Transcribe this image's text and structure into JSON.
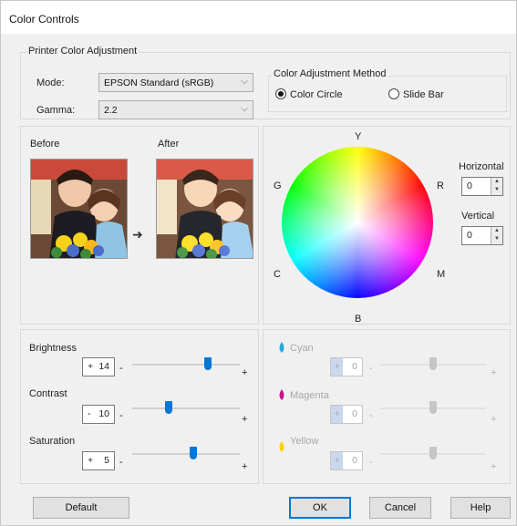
{
  "window": {
    "title": "Color Controls"
  },
  "printer_adjustment": {
    "group_label": "Printer Color Adjustment",
    "mode_label": "Mode:",
    "mode_value": "EPSON Standard (sRGB)",
    "gamma_label": "Gamma:",
    "gamma_value": "2.2"
  },
  "method": {
    "group_label": "Color Adjustment Method",
    "options": [
      {
        "label": "Color Circle",
        "selected": true
      },
      {
        "label": "Slide Bar",
        "selected": false
      }
    ]
  },
  "preview": {
    "before_label": "Before",
    "after_label": "After"
  },
  "color_circle": {
    "labels": {
      "top": "Y",
      "upper_left": "G",
      "upper_right": "R",
      "lower_left": "C",
      "lower_right": "M",
      "bottom": "B"
    },
    "horizontal_label": "Horizontal",
    "horizontal_value": "0",
    "vertical_label": "Vertical",
    "vertical_value": "0"
  },
  "adjustments": [
    {
      "label": "Brightness",
      "sign": "+",
      "value": "14",
      "level": 0.72,
      "color": "#0078d7"
    },
    {
      "label": "Contrast",
      "sign": "-",
      "value": "10",
      "level": 0.33,
      "color": "#0078d7"
    },
    {
      "label": "Saturation",
      "sign": "+",
      "value": "5",
      "level": 0.57,
      "color": "#0078d7"
    }
  ],
  "ink": [
    {
      "label": "Cyan",
      "icon": "cyan-drop-icon",
      "icon_color": "#29a7e0",
      "sign": "+",
      "value": "0",
      "level": 0.5
    },
    {
      "label": "Magenta",
      "icon": "magenta-drop-icon",
      "icon_color": "#c4168c",
      "sign": "+",
      "value": "0",
      "level": 0.5
    },
    {
      "label": "Yellow",
      "icon": "yellow-drop-icon",
      "icon_color": "#f5d400",
      "sign": "+",
      "value": "0",
      "level": 0.5
    }
  ],
  "slider_ends": {
    "minus": "-",
    "plus": "+"
  },
  "arrow_glyph": "➜",
  "buttons": {
    "default": "Default",
    "ok": "OK",
    "cancel": "Cancel",
    "help": "Help"
  }
}
